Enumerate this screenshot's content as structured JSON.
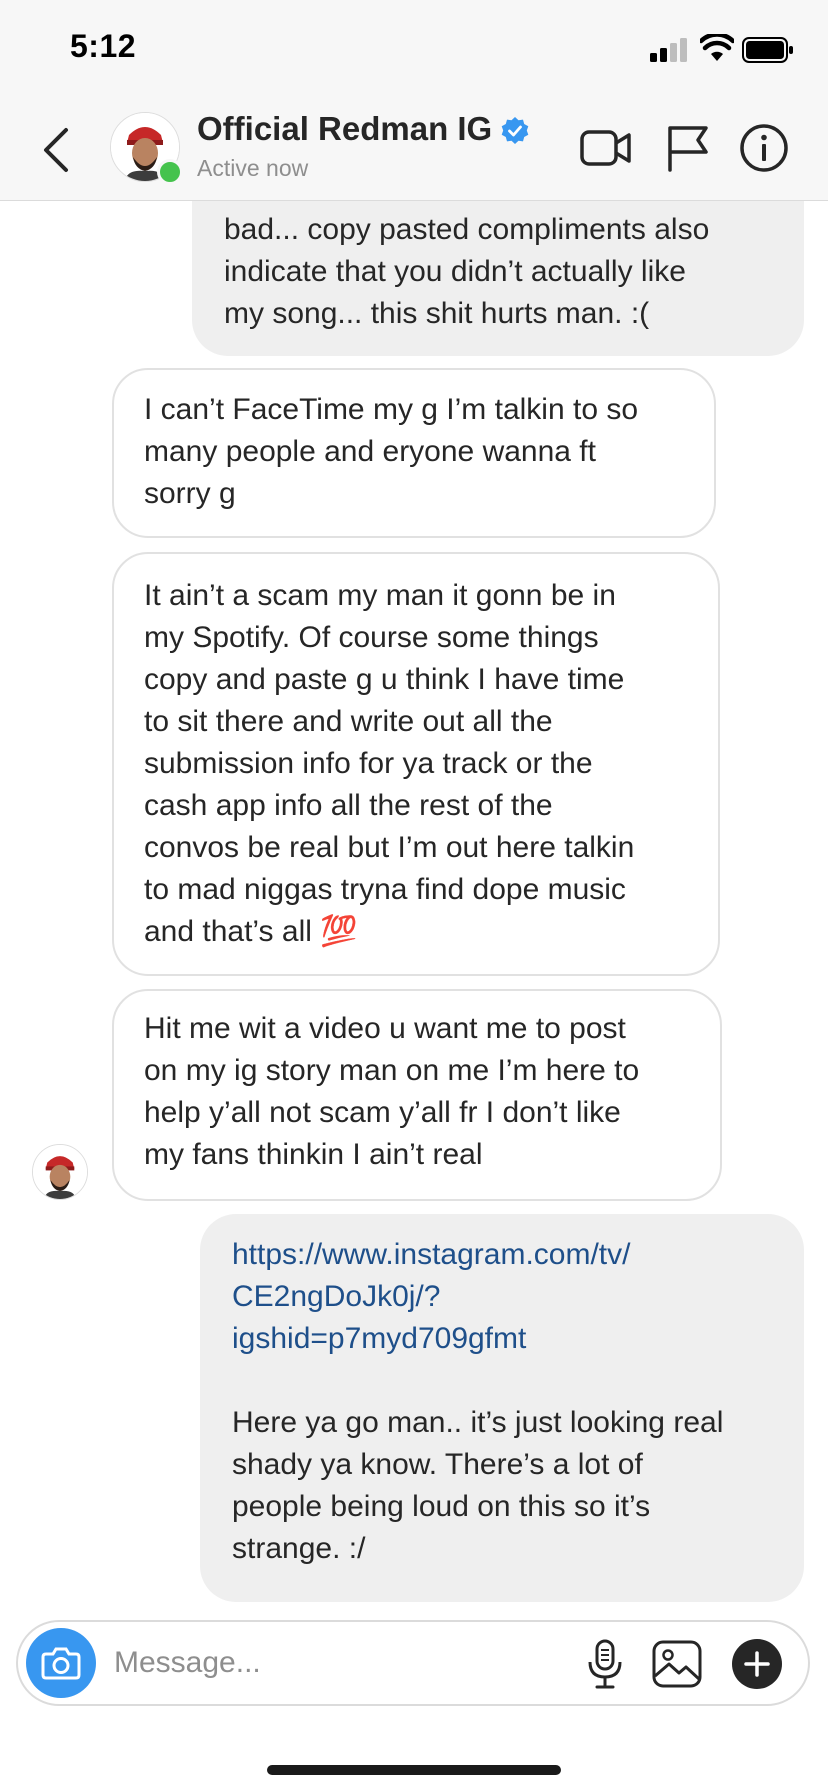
{
  "status_bar": {
    "time": "5:12"
  },
  "header": {
    "name": "Official Redman IG",
    "status": "Active now",
    "icons": [
      "back-chevron-icon",
      "video-call-icon",
      "flag-icon",
      "info-icon",
      "verified-badge-icon"
    ]
  },
  "messages": [
    {
      "sender": "me",
      "text": "bad... copy pasted compliments also\nindicate that you didn’t actually like\nmy song... this shit hurts man. :("
    },
    {
      "sender": "them",
      "text": "I can’t FaceTime my g I’m talkin to so\nmany people and eryone wanna ft\nsorry g"
    },
    {
      "sender": "them",
      "text": "It ain’t a scam my man it gonn be in\nmy Spotify. Of course some things\ncopy and paste g u think I have time\nto sit there and write out all the\nsubmission info for ya track or the\ncash app info all the rest of the\nconvos be real but I’m out here talkin\nto mad niggas tryna find dope music\nand that’s all 💯"
    },
    {
      "sender": "them",
      "text": "Hit me wit a video u want me to post\non my ig story man on me I’m here to\nhelp y’all not scam y’all fr I don’t like\nmy fans thinkin I ain’t real"
    },
    {
      "sender": "me",
      "link": "https://www.instagram.com/tv/\nCE2ngDoJk0j/?\nigshid=p7myd709gfmt",
      "text": "Here ya go man.. it’s just looking real\nshady ya know. There’s a lot of\npeople being loud on this so it’s\nstrange. :/"
    }
  ],
  "composer": {
    "placeholder": "Message...",
    "icons": [
      "camera-icon",
      "microphone-icon",
      "gallery-icon",
      "plus-icon"
    ]
  },
  "colors": {
    "accent": "#3897f0",
    "online": "#45c34d",
    "link": "#1e4f8a",
    "sent_bubble": "#efefef"
  }
}
